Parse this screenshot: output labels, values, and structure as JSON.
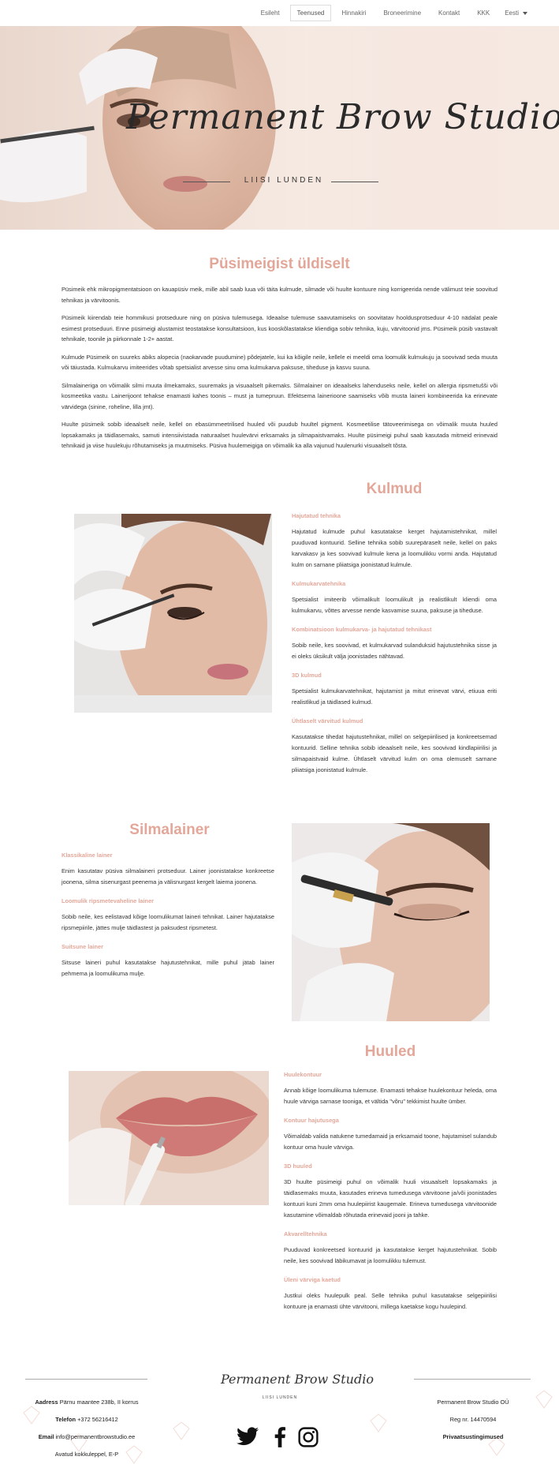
{
  "nav": {
    "items": [
      "Esileht",
      "Teenused",
      "Hinnakiri",
      "Broneerimine",
      "Kontakt",
      "KKK"
    ],
    "active": "Teenused",
    "language": "Eesti"
  },
  "hero": {
    "title": "Permanent Brow Studio",
    "subtitle": "LIISI LUNDEN"
  },
  "intro": {
    "title": "Püsimeigist üldiselt",
    "paragraphs": [
      "Püsimeik ehk mikropigmentatsioon on kauapüsiv meik, mille abil saab luua või täita kulmude, silmade või huulte kontuure ning korrigeerida nende välimust teie soovitud tehnikas ja värvitoonis.",
      "Püsimeik kiirendab teie hommikusi protseduure ning on püsiva tulemusega. Ideaalse tulemuse saavutamiseks on soovitatav hooldusprotseduur 4-10 nädalat peale esimest protseduuri. Enne püsimeigi alustamist teostatakse konsultatsioon, kus kooskõlastatakse kliendiga sobiv tehnika, kuju, värvitoonid jms. Püsimeik püsib vastavalt tehnikale, toonile ja piirkonnale 1-2+ aastat.",
      "Kulmude Püsimeik on suureks abiks alopecia (naokarvade puudumine) põdejatele, kui ka kõigile neile, kellele ei meeldi oma loomulik kulmukuju ja soovivad seda muuta või täiustada. Kulmukarvu imiteerides võtab spetsialist arvesse sinu oma kulmukarva paksuse, tiheduse ja kasvu suuna.",
      "Silmalaineriga on võimalik silmi muuta ilmekamaks, suuremaks ja visuaalselt pikemaks. Silmalainer on ideaalseks lahenduseks neile, kellel on allergia ripsmetušši või kosmeetika vastu. Lainerijoont tehakse enamasti kahes toonis – must ja tumepruun. Efektsema lainerioone saamiseks võib musta laineri kombineerida ka erinevate värvidega (sinine, roheline, lilla jmt).",
      "Huulte püsimeik sobib ideaalselt neile, kellel on ebasümmeetrilised huuled või puudub huultel pigment. Kosmeetilise tätoveerimisega on võimalik muuta huuled lopsakamaks ja täidlasemaks, samuti intensiivistada naturaalset huulevärvi erksamaks ja silmapaistvamaks. Huulte püsimeigi puhul saab kasutada mitmeid erinevaid tehnikaid ja viise huulekuju rõhutamiseks ja muutmiseks. Püsiva huulemeigiga on võimalik ka alla vajunud huulenurki visuaalselt tõsta."
    ]
  },
  "brows": {
    "title": "Kulmud",
    "items": [
      {
        "heading": "Hajutatud tehnika",
        "text": "Hajutatud kulmude puhul kasutatakse kerget hajutamistehnikat, millel puuduvad kontuurid. Selline tehnika sobib suurepäraselt neile, kellel on paks karvakasv ja kes soovivad kulmule kena ja loomulikku vormi anda. Hajutatud kulm on sarnane pliiatsiga joonistatud kulmule."
      },
      {
        "heading": "Kulmukarvatehnika",
        "text": "Spetsialist imiteerib võimalikult loomulikult ja realistlikult kliendi oma kulmukarvu, võttes arvesse nende kasvamise suuna, paksuse ja tiheduse."
      },
      {
        "heading": "Kombinatsioon kulmukarva- ja hajutatud tehnikast",
        "text": "Sobib neile, kes soovivad, et kulmukarvad sulanduksid hajutustehnika sisse ja ei oleks üksikult välja joonistades nähtavad."
      },
      {
        "heading": "3D kulmud",
        "text": "Spetsialist kulmukarvatehnikat, hajutamist ja mitut erinevat värvi, etiuua eriti realistlikud ja täidlased kulmud."
      },
      {
        "heading": "Ühtlaselt värvitud kulmud",
        "text": "Kasutatakse tihedat hajutustehnikat, millel on selgepiirilised ja konkreetsemad kontuurid. Selline tehnika sobib ideaalselt neile, kes soovivad kindlapiirilisi ja silmapaistvaid kulme. Ühtlaselt värvitud kulm on oma olemuselt sarnane pliiatsiga joonistatud kulmule."
      }
    ]
  },
  "liner": {
    "title": "Silmalainer",
    "items": [
      {
        "heading": "Klassikaline lainer",
        "text": "Enim kasutatav püsiva silmalaineri protseduur. Lainer joonistatakse konkreetse joonena, silma sisenurgast peenema ja välisnurgast kergelt laiema joonena."
      },
      {
        "heading": "Loomulik ripsmetevaheline lainer",
        "text": "Sobib neile, kes eelistavad kõige loomulikumat laineri tehnikat. Lainer hajutatakse ripsmepiirile, jättes mulje täidlastest ja paksudest ripsmetest."
      },
      {
        "heading": "Suitsune lainer",
        "text": "Sitsuse laineri puhul kasutatakse hajutustehnikat, mille puhul jätab lainer pehmema ja loomulikuma mulje."
      }
    ]
  },
  "lips": {
    "title": "Huuled",
    "items": [
      {
        "heading": "Huulekontuur",
        "text": "Annab kõige loomulikuma tulemuse. Enamasti tehakse huulekontuur heleda, oma huule värviga sarnase tooniga, et vältida \"võru\" tekkimist huulte ümber."
      },
      {
        "heading": "Kontuur hajutusega",
        "text": "Võimaldab valida natukene tumedamaid ja erksamaid toone, hajutamisel sulandub kontuur oma huule värviga."
      },
      {
        "heading": "3D huuled",
        "text": "3D huulte püsimeigi puhul on võimalik huuli visuaalselt lopsakamaks ja täidlasemaks muuta, kasutades erineva tumedusega värvitoone ja/või joonistades kontuuri kuni 2mm oma huulepiirist kaugemale. Erineva tumedusega värvitoonide kasutamine võimaldab rõhutada erinevaid jooni ja tahke."
      },
      {
        "heading": "Akvarelltehnika",
        "text": "Puuduvad konkreetsed kontuurid ja kasutatakse kerget hajutustehnikat. Sobib neile, kes soovivad läbikumavat ja loomulikku tulemust."
      },
      {
        "heading": "Üleni värviga kaetud",
        "text": "Justkui oleks huulepulk peal. Selle tehnika puhul kasutatakse selgepiirilisi kontuure ja enamasti ühte värvitooni, millega kaetakse kogu huulepind."
      }
    ]
  },
  "footer": {
    "logo": "Permanent Brow Studio",
    "logo_sub": "LIISI LUNDEN",
    "address_label": "Aadress",
    "address": "Pärnu maantee 238b, II korrus",
    "phone_label": "Telefon",
    "phone": "+372 56216412",
    "email_label": "Email",
    "email": "info@permanentbrowstudio.ee",
    "hours": "Avatud kokkuleppel, E-P",
    "company": "Permanent Brow Studio OÜ",
    "reg": "Reg nr. 14470594",
    "privacy": "Privaatsustingimused",
    "social": [
      "twitter-icon",
      "facebook-icon",
      "instagram-icon"
    ]
  },
  "colors": {
    "accent": "#e3a79a",
    "text": "#333333",
    "hero_bg": "#f4e6de"
  }
}
